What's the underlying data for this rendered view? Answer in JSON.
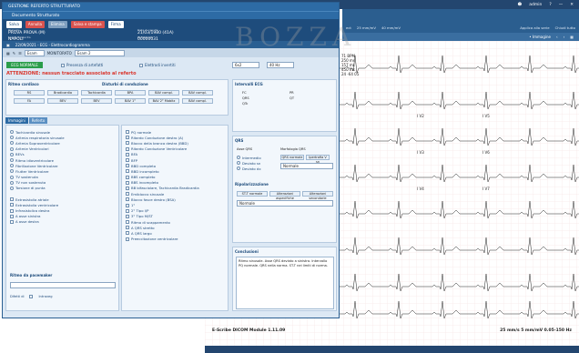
{
  "topbar": {
    "user": "admin"
  },
  "toolbar2": {
    "items": [
      "ect",
      "25 mm/mV",
      "40 mm/mV"
    ],
    "right_items": [
      "Applica alla serie",
      "Chiudi tutto"
    ]
  },
  "toolbar3": {
    "label": "• Immagine"
  },
  "ecg": {
    "patient_values": [
      "71 BPM",
      "250 ms",
      "157 ms",
      "450 ms",
      "24 -64 05"
    ],
    "lead_labels": [
      "I V2",
      "I V5",
      "I V3",
      "I V6",
      "I V4",
      "I V7"
    ],
    "software": "E-Scribe DICOM Module 1.11.09",
    "scale": "25 mm/s  5 mm/mV  0.05-150 Hz"
  },
  "watermark": "BOZZA",
  "dialog": {
    "title": "GESTIONE REFERTO STRUTTURATO",
    "subtitle": "Documento Strutturato",
    "header": {
      "save_label": "Salva",
      "cancel_label": "Annulla",
      "delete_label": "Elimina",
      "save_print_label": "Salva e stampa",
      "signature_label": "Firma",
      "patient_caption": "Paziente",
      "patient_name": "PROVA PROVA (M)",
      "birthplace_caption": "Luogo di nascita",
      "birthplace": "NAPOLI",
      "dob_caption": "Data di nascita",
      "dob": "21/03/1980 (41A)",
      "id_caption": "ID Paziente",
      "patient_id": "00000031"
    },
    "exam_label": "22/09/2021 - ECG - Elettrocardiogramma",
    "toolbar": {
      "exam_select": "Esam",
      "monitor_label": "MONITORATO",
      "exam2": "Esam 2"
    },
    "ecg_normal_label": "ECG NORMALE",
    "artifacts_label": "Presenza di artefatti",
    "inverted_label": "Elettrodi invertiti",
    "speed_select": "6x2",
    "freq_select": "40 Hz",
    "warning": "ATTENZIONE: nessun tracciato associato al referto",
    "rhythm_title": "Ritmo cardiaco",
    "rhythm_buttons": [
      "RS",
      "Bradicardia",
      "Tachicardia",
      "BPA",
      "BAV compl.",
      "BAV compl."
    ],
    "rhythm_buttons2": [
      "FA",
      "BEV",
      "BEV",
      "BAV 1°",
      "BAV 2° Mobitz",
      "BAV compl."
    ],
    "conduction_title": "Disturbi di conduzione",
    "intervals_title": "Intervalli ECG",
    "interval_labels": [
      "FC",
      "PR",
      "QRS",
      "QT",
      "QTc"
    ],
    "tabs": [
      "Immagini",
      "Referto"
    ],
    "left_list": [
      "Tachicardia sinusale",
      "Aritmia respiratoria sinusale",
      "Aritmia Sopraventricolare",
      "Aritmie Ventricolari",
      "BEVs",
      "Ritmo idioventricolare",
      "Fibrillazione Ventricolare",
      "Flutter Ventricolare",
      "TV sostenuta",
      "TV non sostenuta",
      "Torsione di punta"
    ],
    "left_list2": [
      "Extrasistolia atriale",
      "Extrasistolia ventricolare",
      "Infrasistolica destra",
      "A asse sinistra",
      "A asse destra"
    ],
    "pacemaker_label": "Ritmo da pacemaker",
    "defect_label": "Difetti di",
    "defect_sub": "Intraveg",
    "mid_list": [
      "PQ normale",
      "Ritardo Conduzione destro (A)",
      "Blocco della branca destra (BBD)",
      "Ritardo Conduzione Ventricolare",
      "BFA",
      "BFP",
      "BBD completo",
      "BBD incompleto",
      "BBS completo",
      "BBS incompleto",
      "BB bifasciolare, Tachicardia Bradicardia",
      "Emiblocco sinusale",
      "Blocco fasce destro (BSA)",
      "1°",
      "2° Tipo I/P",
      "3° Tipo M/ST",
      "Ritmo di scappamento",
      "A QRS stretto",
      "A QRS largo",
      "Preeccitazione ventricolare"
    ],
    "qrs_title": "QRS",
    "qrs_axis_title": "Asse QRS",
    "qrs_morph_title": "Morfologia QRS",
    "qrs_axis_options": [
      "Intermedio",
      "Deviato sn",
      "Deviato dx"
    ],
    "qrs_morph_buttons": [
      "QRS normale",
      "Ipertrofia V sn"
    ],
    "qrs_morph_select": "Normale",
    "repol_title": "Ripolarizzazione",
    "repol_buttons": [
      "ST-T normale",
      "Alterazioni aspecifiche",
      "Alterazioni secondarie"
    ],
    "repol_select": "Normale",
    "conclusion_title": "Conclusioni",
    "conclusion_text": "Ritmo sinusale. Asse QRS deviato a sinistra. Intervallo PQ normale. QRS nella norma. ST-T nei limiti di norma."
  }
}
